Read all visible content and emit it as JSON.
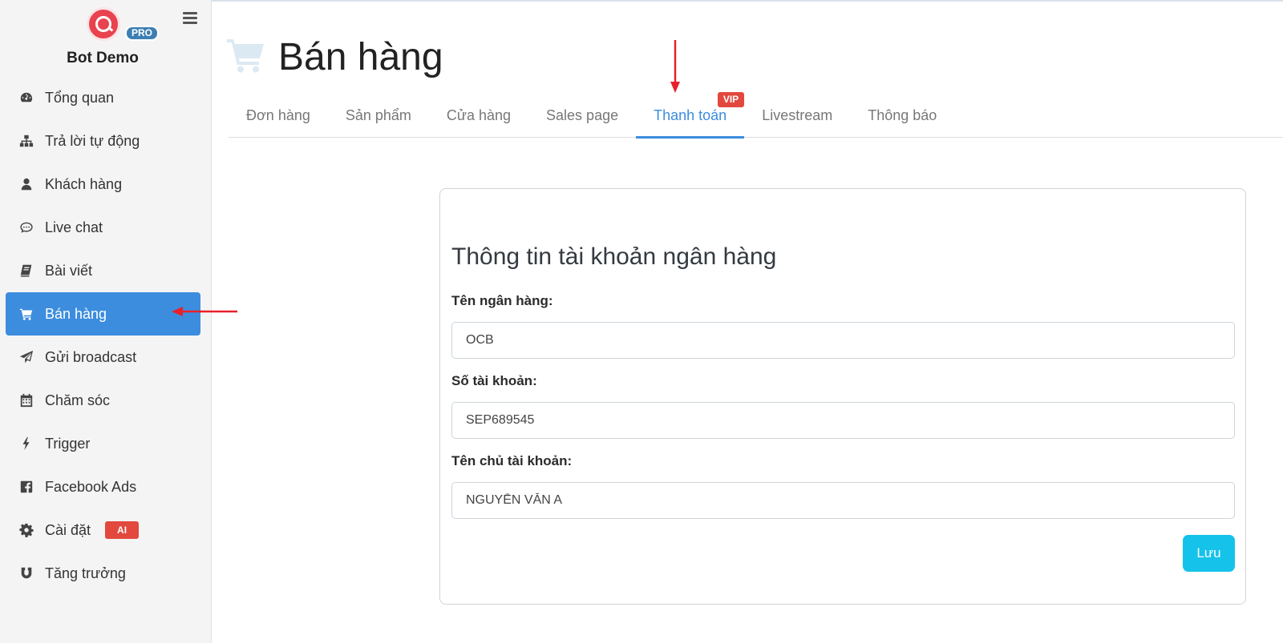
{
  "brand": {
    "name": "Bot Demo",
    "badge": "PRO"
  },
  "sidebar": {
    "items": [
      {
        "label": "Tổng quan",
        "icon": "dashboard-icon"
      },
      {
        "label": "Trả lời tự động",
        "icon": "sitemap-icon"
      },
      {
        "label": "Khách hàng",
        "icon": "user-icon"
      },
      {
        "label": "Live chat",
        "icon": "chat-icon"
      },
      {
        "label": "Bài viết",
        "icon": "book-icon"
      },
      {
        "label": "Bán hàng",
        "icon": "cart-icon",
        "active": true
      },
      {
        "label": "Gửi broadcast",
        "icon": "paper-plane-icon"
      },
      {
        "label": "Chăm sóc",
        "icon": "calendar-icon"
      },
      {
        "label": "Trigger",
        "icon": "bolt-icon"
      },
      {
        "label": "Facebook Ads",
        "icon": "facebook-icon"
      },
      {
        "label": "Cài đặt",
        "icon": "gear-icon",
        "badge": "AI"
      },
      {
        "label": "Tăng trưởng",
        "icon": "magnet-icon"
      }
    ]
  },
  "page": {
    "title": "Bán hàng"
  },
  "tabs": [
    {
      "label": "Đơn hàng"
    },
    {
      "label": "Sản phẩm"
    },
    {
      "label": "Cửa hàng"
    },
    {
      "label": "Sales page"
    },
    {
      "label": "Thanh toán",
      "active": true,
      "badge": "VIP"
    },
    {
      "label": "Livestream"
    },
    {
      "label": "Thông báo"
    }
  ],
  "form": {
    "title": "Thông tin tài khoản ngân hàng",
    "bank_name_label": "Tên ngân hàng:",
    "bank_name_value": "OCB",
    "account_number_label": "Số tài khoản:",
    "account_number_value": "SEP689545",
    "account_holder_label": "Tên chủ tài khoản:",
    "account_holder_value": "NGUYỄN VĂN A",
    "save_label": "Lưu"
  },
  "colors": {
    "accent": "#3c8dde",
    "badge_red": "#e2483e",
    "save_button": "#14c2ea",
    "annotation_arrow": "#e8202a"
  }
}
